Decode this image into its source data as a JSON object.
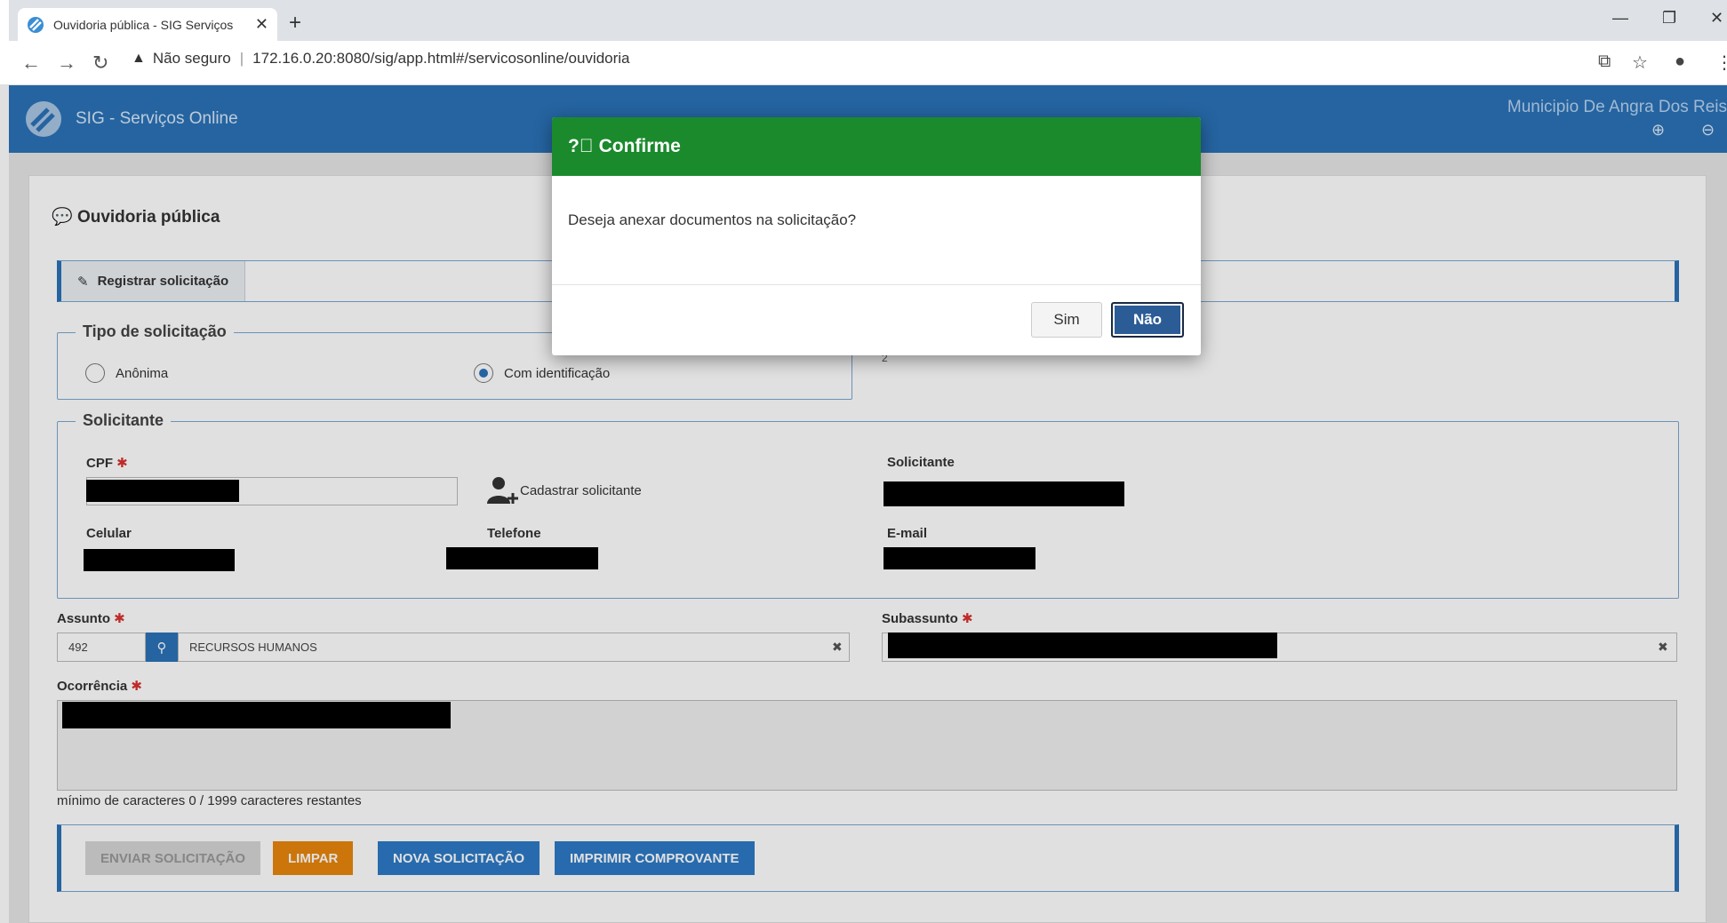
{
  "browser": {
    "tab_title": "Ouvidoria pública - SIG Serviços",
    "security_label": "Não seguro",
    "url": "172.16.0.20:8080/sig/app.html#/servicosonline/ouvidoria"
  },
  "header": {
    "app_title": "SIG - Serviços Online",
    "municipality": "Municipio De Angra Dos Reis"
  },
  "page": {
    "title": "Ouvidoria pública",
    "tab_label": "Registrar solicitação"
  },
  "tipo": {
    "legend": "Tipo de solicitação",
    "options": [
      "Anônima",
      "Com identificação"
    ],
    "selected": "Com identificação",
    "side_value": "2"
  },
  "solicitante": {
    "legend": "Solicitante",
    "cpf_label": "CPF",
    "cadastrar_label": "Cadastrar solicitante",
    "solicitante_label": "Solicitante",
    "celular_label": "Celular",
    "telefone_label": "Telefone",
    "email_label": "E-mail"
  },
  "assunto": {
    "label": "Assunto",
    "code": "492",
    "value": "RECURSOS HUMANOS",
    "clear": "✖"
  },
  "subassunto": {
    "label": "Subassunto",
    "clear": "✖"
  },
  "ocorrencia": {
    "label": "Ocorrência",
    "counter": "mínimo de caracteres 0 / 1999 caracteres restantes"
  },
  "actions": {
    "enviar": "ENVIAR SOLICITAÇÃO",
    "limpar": "LIMPAR",
    "nova": "NOVA SOLICITAÇÃO",
    "imprimir": "IMPRIMIR COMPROVANTE"
  },
  "modal": {
    "title": "Confirme",
    "message": "Deseja anexar documentos na solicitação?",
    "yes": "Sim",
    "no": "Não"
  },
  "colors": {
    "header_blue": "#2b72b8",
    "modal_green": "#1a8a2c",
    "limpar_orange": "#e8860c",
    "action_blue": "#2d7ac7",
    "disabled_gray": "#d5d5d5"
  }
}
